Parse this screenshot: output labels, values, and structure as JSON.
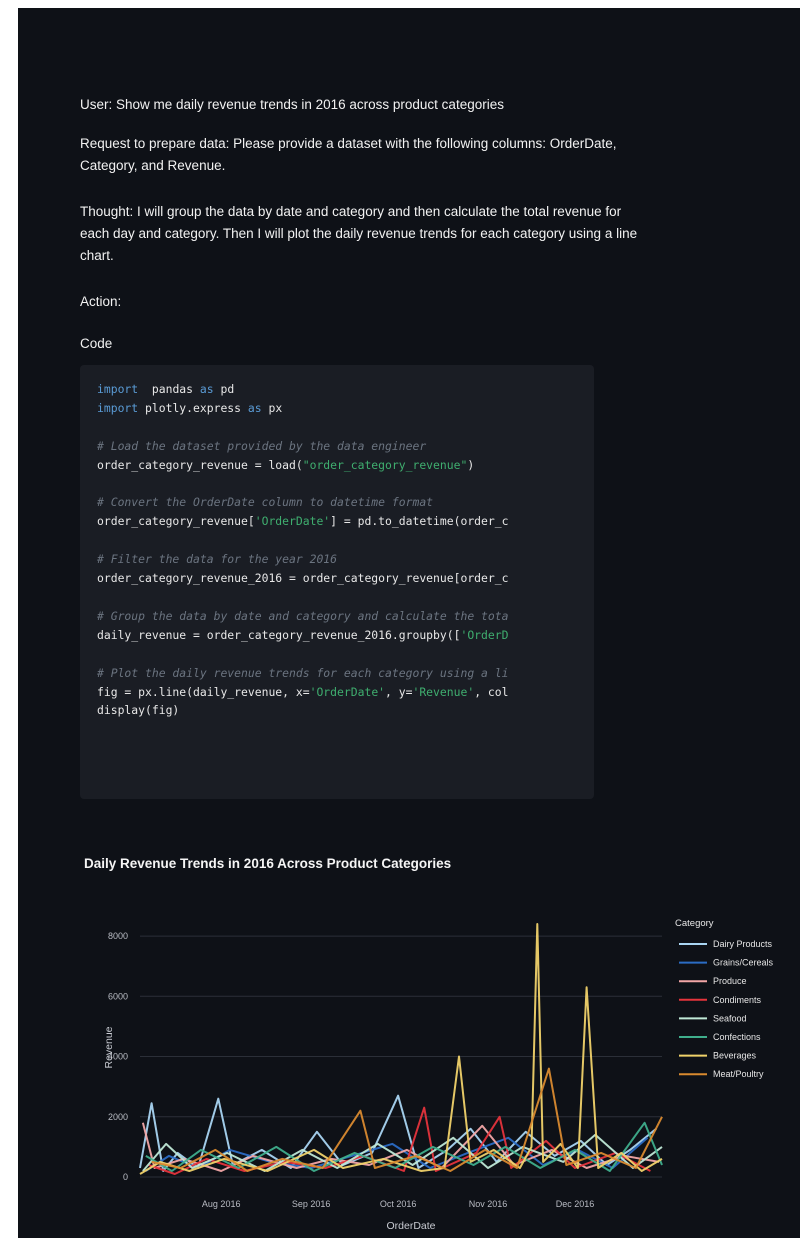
{
  "message": {
    "user_line": "User: Show me daily revenue trends in 2016 across product categories",
    "request_line": "Request to prepare data: Please provide a dataset with the following columns: OrderDate, Category, and Revenue.",
    "thought_line": "Thought: I will group the data by date and category and then calculate the total revenue for each day and category. Then I will plot the daily revenue trends for each category using a line chart.",
    "action_label": "Action:",
    "code_label": "Code"
  },
  "code": {
    "lines": [
      {
        "segs": [
          [
            "kw",
            "import"
          ],
          [
            "",
            "  pandas "
          ],
          [
            "kw",
            "as"
          ],
          [
            "",
            " pd"
          ]
        ]
      },
      {
        "segs": [
          [
            "kw",
            "import"
          ],
          [
            "",
            " plotly.express "
          ],
          [
            "kw",
            "as"
          ],
          [
            "",
            " px"
          ]
        ]
      },
      {
        "segs": []
      },
      {
        "segs": [
          [
            "cm",
            "# Load the dataset provided by the data engineer"
          ]
        ]
      },
      {
        "segs": [
          [
            "",
            "order_category_revenue = load("
          ],
          [
            "st",
            "\"order_category_revenue\""
          ],
          [
            "",
            ")"
          ]
        ]
      },
      {
        "segs": []
      },
      {
        "segs": [
          [
            "cm",
            "# Convert the OrderDate column to datetime format"
          ]
        ]
      },
      {
        "segs": [
          [
            "",
            "order_category_revenue["
          ],
          [
            "st",
            "'OrderDate'"
          ],
          [
            "",
            "] = pd.to_datetime(order_c"
          ]
        ]
      },
      {
        "segs": []
      },
      {
        "segs": [
          [
            "cm",
            "# Filter the data for the year 2016"
          ]
        ]
      },
      {
        "segs": [
          [
            "",
            "order_category_revenue_2016 = order_category_revenue[order_c"
          ]
        ]
      },
      {
        "segs": []
      },
      {
        "segs": [
          [
            "cm",
            "# Group the data by date and category and calculate the tota"
          ]
        ]
      },
      {
        "segs": [
          [
            "",
            "daily_revenue = order_category_revenue_2016.groupby(["
          ],
          [
            "st",
            "'OrderD"
          ]
        ]
      },
      {
        "segs": []
      },
      {
        "segs": [
          [
            "cm",
            "# Plot the daily revenue trends for each category using a li"
          ]
        ]
      },
      {
        "segs": [
          [
            "",
            "fig = px.line(daily_revenue, x="
          ],
          [
            "st",
            "'OrderDate'"
          ],
          [
            "",
            ", y="
          ],
          [
            "st",
            "'Revenue'"
          ],
          [
            "",
            ", col"
          ]
        ]
      },
      {
        "segs": [
          [
            "",
            "display(fig)"
          ]
        ]
      }
    ]
  },
  "chart_data": {
    "type": "line",
    "title": "Daily Revenue Trends in 2016 Across Product Categories",
    "xlabel": "OrderDate",
    "ylabel": "Revenue",
    "x_ticks": [
      "Aug 2016",
      "Sep 2016",
      "Oct 2016",
      "Nov 2016",
      "Dec 2016"
    ],
    "x_range": [
      "2016-07-04",
      "2016-12-31"
    ],
    "y_ticks": [
      0,
      2000,
      4000,
      6000,
      8000
    ],
    "ylim": [
      0,
      8600
    ],
    "grid": true,
    "legend_title": "Category",
    "legend_placement": "right",
    "series": [
      {
        "name": "Dairy Products",
        "color": "#a9d5f2",
        "points": [
          [
            "2016-07-04",
            300
          ],
          [
            "2016-07-08",
            2450
          ],
          [
            "2016-07-12",
            200
          ],
          [
            "2016-07-17",
            800
          ],
          [
            "2016-07-24",
            300
          ],
          [
            "2016-07-31",
            2600
          ],
          [
            "2016-08-05",
            400
          ],
          [
            "2016-08-15",
            900
          ],
          [
            "2016-08-25",
            300
          ],
          [
            "2016-09-03",
            1500
          ],
          [
            "2016-09-12",
            400
          ],
          [
            "2016-09-22",
            800
          ],
          [
            "2016-10-01",
            2700
          ],
          [
            "2016-10-08",
            300
          ],
          [
            "2016-10-18",
            900
          ],
          [
            "2016-10-26",
            1600
          ],
          [
            "2016-11-04",
            500
          ],
          [
            "2016-11-14",
            1500
          ],
          [
            "2016-11-24",
            700
          ],
          [
            "2016-12-03",
            1200
          ],
          [
            "2016-12-12",
            400
          ],
          [
            "2016-12-20",
            900
          ],
          [
            "2016-12-29",
            1600
          ]
        ]
      },
      {
        "name": "Grains/Cereals",
        "color": "#2b6cc4",
        "points": [
          [
            "2016-07-06",
            200
          ],
          [
            "2016-07-14",
            700
          ],
          [
            "2016-07-24",
            300
          ],
          [
            "2016-08-04",
            900
          ],
          [
            "2016-08-18",
            500
          ],
          [
            "2016-09-01",
            300
          ],
          [
            "2016-09-15",
            700
          ],
          [
            "2016-09-29",
            1100
          ],
          [
            "2016-10-12",
            300
          ],
          [
            "2016-10-25",
            800
          ],
          [
            "2016-11-08",
            1300
          ],
          [
            "2016-11-20",
            400
          ],
          [
            "2016-12-02",
            900
          ],
          [
            "2016-12-14",
            300
          ],
          [
            "2016-12-26",
            1300
          ]
        ]
      },
      {
        "name": "Produce",
        "color": "#f2a6a6",
        "points": [
          [
            "2016-07-05",
            1800
          ],
          [
            "2016-07-09",
            300
          ],
          [
            "2016-07-19",
            600
          ],
          [
            "2016-08-01",
            200
          ],
          [
            "2016-08-12",
            700
          ],
          [
            "2016-08-27",
            300
          ],
          [
            "2016-09-08",
            600
          ],
          [
            "2016-09-21",
            400
          ],
          [
            "2016-10-04",
            900
          ],
          [
            "2016-10-16",
            300
          ],
          [
            "2016-10-30",
            1700
          ],
          [
            "2016-11-10",
            400
          ],
          [
            "2016-11-23",
            900
          ],
          [
            "2016-12-05",
            300
          ],
          [
            "2016-12-18",
            700
          ],
          [
            "2016-12-30",
            500
          ]
        ]
      },
      {
        "name": "Condiments",
        "color": "#e5343c",
        "points": [
          [
            "2016-07-07",
            400
          ],
          [
            "2016-07-16",
            100
          ],
          [
            "2016-07-27",
            600
          ],
          [
            "2016-08-09",
            200
          ],
          [
            "2016-08-23",
            500
          ],
          [
            "2016-09-06",
            300
          ],
          [
            "2016-09-19",
            700
          ],
          [
            "2016-10-03",
            200
          ],
          [
            "2016-10-10",
            2300
          ],
          [
            "2016-10-14",
            200
          ],
          [
            "2016-10-28",
            800
          ],
          [
            "2016-11-05",
            2000
          ],
          [
            "2016-11-09",
            300
          ],
          [
            "2016-11-21",
            1200
          ],
          [
            "2016-12-01",
            300
          ],
          [
            "2016-12-15",
            800
          ],
          [
            "2016-12-27",
            200
          ]
        ]
      },
      {
        "name": "Seafood",
        "color": "#bfe8d6",
        "points": [
          [
            "2016-07-05",
            200
          ],
          [
            "2016-07-13",
            1100
          ],
          [
            "2016-07-22",
            300
          ],
          [
            "2016-08-03",
            800
          ],
          [
            "2016-08-16",
            200
          ],
          [
            "2016-08-29",
            900
          ],
          [
            "2016-09-10",
            300
          ],
          [
            "2016-09-24",
            1100
          ],
          [
            "2016-10-06",
            400
          ],
          [
            "2016-10-20",
            1300
          ],
          [
            "2016-11-01",
            300
          ],
          [
            "2016-11-13",
            1000
          ],
          [
            "2016-11-27",
            500
          ],
          [
            "2016-12-08",
            1400
          ],
          [
            "2016-12-21",
            300
          ],
          [
            "2016-12-31",
            1000
          ]
        ]
      },
      {
        "name": "Confections",
        "color": "#3fae8c",
        "points": [
          [
            "2016-07-06",
            700
          ],
          [
            "2016-07-15",
            200
          ],
          [
            "2016-07-25",
            900
          ],
          [
            "2016-08-07",
            300
          ],
          [
            "2016-08-20",
            1000
          ],
          [
            "2016-09-02",
            200
          ],
          [
            "2016-09-16",
            800
          ],
          [
            "2016-09-30",
            300
          ],
          [
            "2016-10-13",
            1000
          ],
          [
            "2016-10-27",
            400
          ],
          [
            "2016-11-07",
            1000
          ],
          [
            "2016-11-19",
            300
          ],
          [
            "2016-12-01",
            900
          ],
          [
            "2016-12-13",
            200
          ],
          [
            "2016-12-25",
            1800
          ],
          [
            "2016-12-31",
            400
          ]
        ]
      },
      {
        "name": "Beverages",
        "color": "#f0d26a",
        "points": [
          [
            "2016-07-04",
            100
          ],
          [
            "2016-07-11",
            500
          ],
          [
            "2016-07-21",
            200
          ],
          [
            "2016-08-02",
            600
          ],
          [
            "2016-08-17",
            200
          ],
          [
            "2016-09-02",
            900
          ],
          [
            "2016-09-12",
            300
          ],
          [
            "2016-09-26",
            600
          ],
          [
            "2016-10-09",
            200
          ],
          [
            "2016-10-17",
            300
          ],
          [
            "2016-10-22",
            4000
          ],
          [
            "2016-10-26",
            500
          ],
          [
            "2016-11-03",
            900
          ],
          [
            "2016-11-12",
            300
          ],
          [
            "2016-11-16",
            1000
          ],
          [
            "2016-11-18",
            8400
          ],
          [
            "2016-11-20",
            500
          ],
          [
            "2016-11-26",
            1100
          ],
          [
            "2016-12-02",
            300
          ],
          [
            "2016-12-05",
            6300
          ],
          [
            "2016-12-09",
            300
          ],
          [
            "2016-12-17",
            800
          ],
          [
            "2016-12-24",
            200
          ],
          [
            "2016-12-31",
            600
          ]
        ]
      },
      {
        "name": "Meat/Poultry",
        "color": "#d98a2f",
        "points": [
          [
            "2016-07-08",
            500
          ],
          [
            "2016-07-18",
            300
          ],
          [
            "2016-07-30",
            900
          ],
          [
            "2016-08-10",
            200
          ],
          [
            "2016-08-22",
            600
          ],
          [
            "2016-09-05",
            300
          ],
          [
            "2016-09-18",
            2200
          ],
          [
            "2016-09-23",
            300
          ],
          [
            "2016-10-07",
            700
          ],
          [
            "2016-10-19",
            200
          ],
          [
            "2016-10-31",
            900
          ],
          [
            "2016-11-11",
            300
          ],
          [
            "2016-11-22",
            3600
          ],
          [
            "2016-11-28",
            400
          ],
          [
            "2016-12-10",
            800
          ],
          [
            "2016-12-22",
            300
          ],
          [
            "2016-12-31",
            2000
          ]
        ]
      }
    ]
  }
}
